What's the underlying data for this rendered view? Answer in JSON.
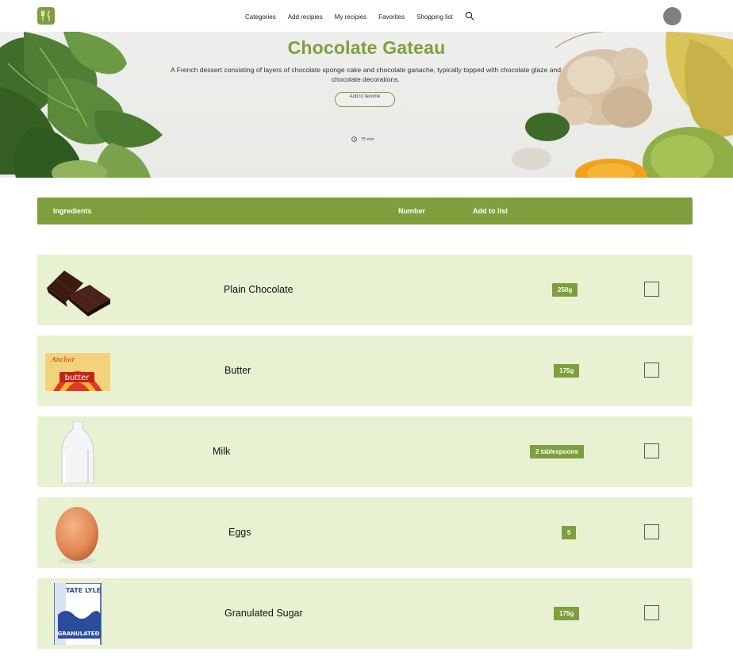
{
  "nav": {
    "links": [
      "Categories",
      "Add recipies",
      "My recipies",
      "Favorites",
      "Shopping list"
    ],
    "search_icon": "search-icon",
    "avatar_color": "#7f7f7f"
  },
  "hero": {
    "title": "Chocolate Gateau",
    "description": "A French dessert consisting of layers of chocolate sponge cake and chocolate ganache, typically topped with chocolate glaze and chocolate decorations.",
    "favorite_button": "Add to favorite",
    "time": "75 min",
    "time_icon": "clock-icon"
  },
  "table": {
    "headers": {
      "ingredients": "Ingredients",
      "number": "Number",
      "add_to_list": "Add to list"
    },
    "rows": [
      {
        "name": "Plain Chocolate",
        "quantity": "250g",
        "image": "chocolate",
        "checked": false
      },
      {
        "name": "Butter",
        "quantity": "175g",
        "image": "butter",
        "checked": false
      },
      {
        "name": "Milk",
        "quantity": "2 tablespoons",
        "image": "milk",
        "checked": false
      },
      {
        "name": "Eggs",
        "quantity": "5",
        "image": "egg",
        "checked": false
      },
      {
        "name": "Granulated Sugar",
        "quantity": "175g",
        "image": "sugar",
        "checked": false
      }
    ]
  },
  "colors": {
    "accent": "#7e9f3c",
    "row_bg": "#e8f2d3",
    "hero_bg": "#eeeeec"
  },
  "thumbnail_texts": {
    "butter_brand": "Anchor",
    "butter_label": "butter",
    "sugar_brand": "TATE LYLE",
    "sugar_label": "GRANULATED"
  }
}
